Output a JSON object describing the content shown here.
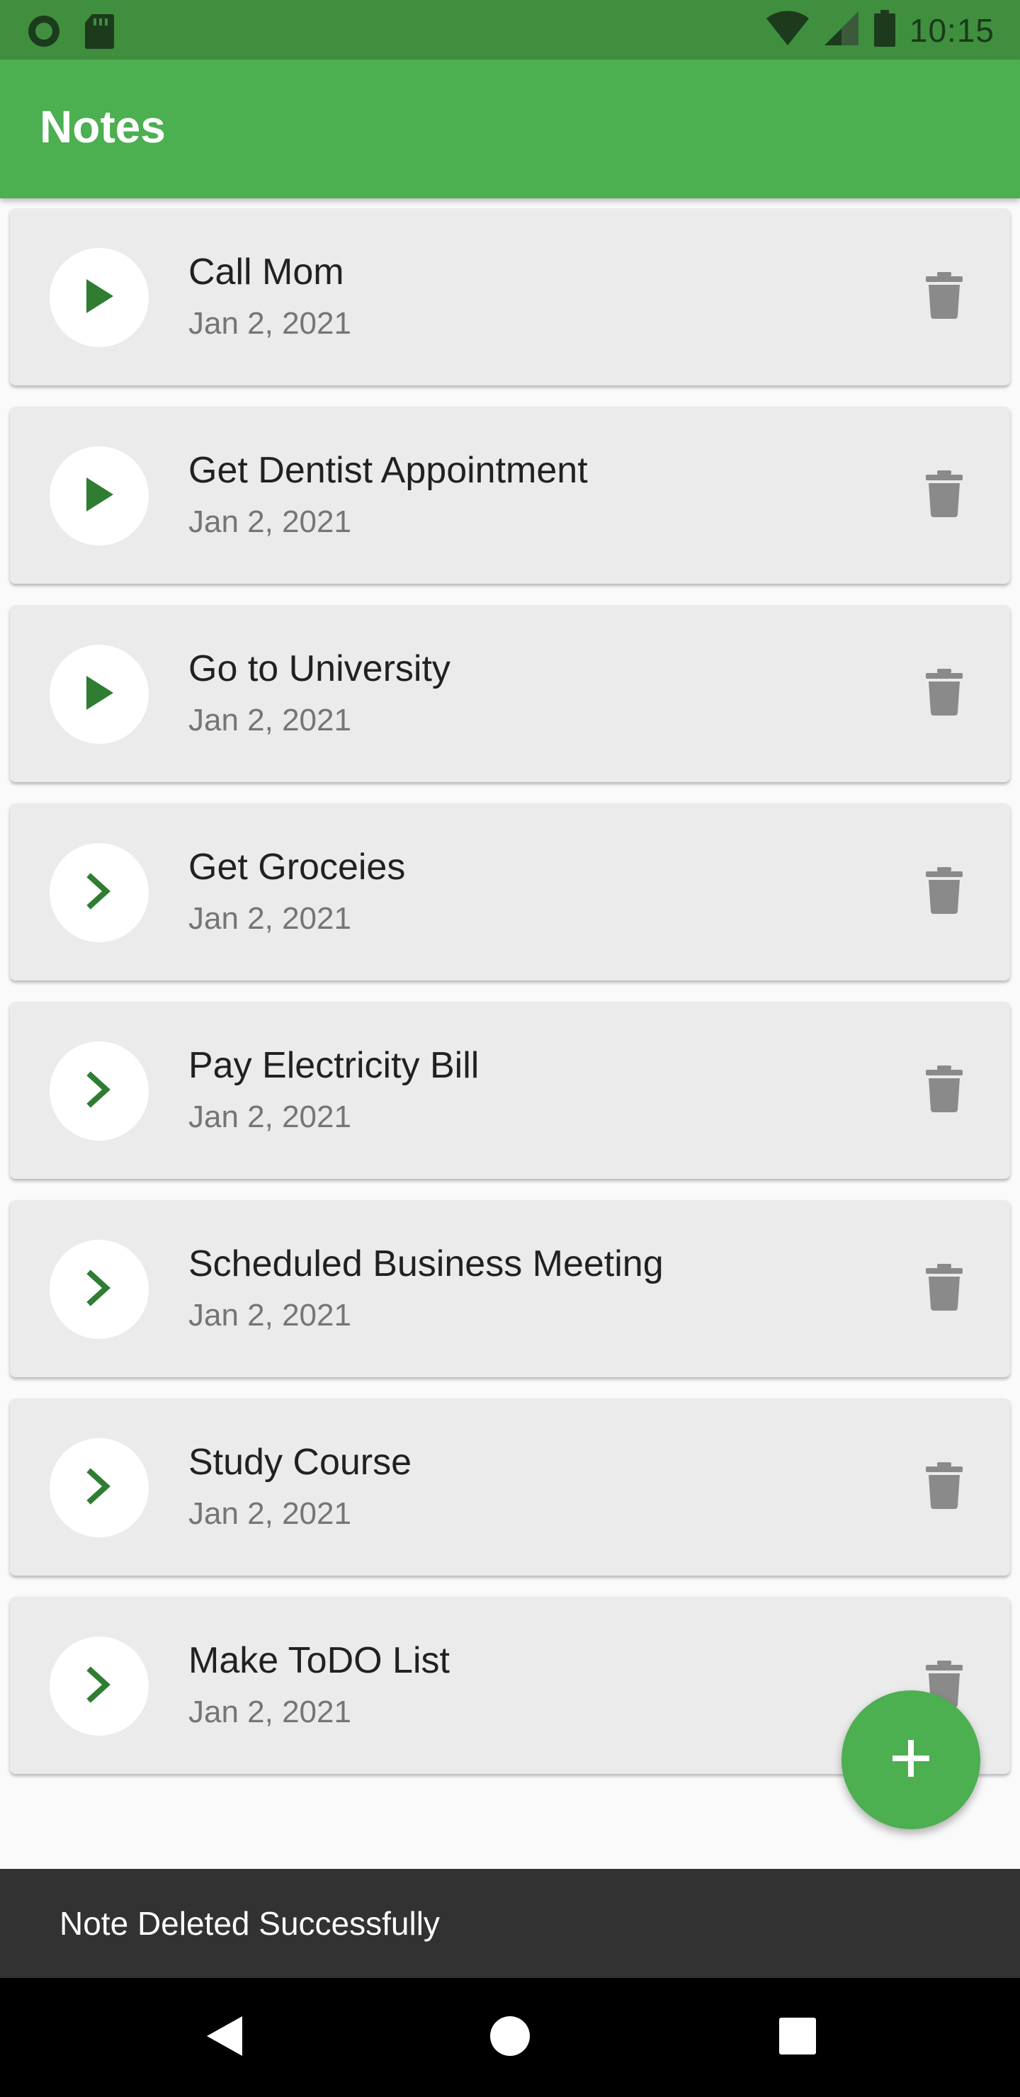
{
  "status_bar": {
    "time": "10:15",
    "icons": [
      "circle-status-icon",
      "sd-card-icon",
      "wifi-icon",
      "signal-icon",
      "battery-icon"
    ]
  },
  "app_bar": {
    "title": "Notes"
  },
  "notes": [
    {
      "title": "Call Mom",
      "date": "Jan 2, 2021",
      "icon": "play-icon"
    },
    {
      "title": "Get Dentist Appointment",
      "date": "Jan 2, 2021",
      "icon": "play-icon"
    },
    {
      "title": "Go to University",
      "date": "Jan 2, 2021",
      "icon": "play-icon"
    },
    {
      "title": "Get Groceies",
      "date": "Jan 2, 2021",
      "icon": "chevron-right-icon"
    },
    {
      "title": "Pay Electricity Bill",
      "date": "Jan 2, 2021",
      "icon": "chevron-right-icon"
    },
    {
      "title": "Scheduled Business Meeting",
      "date": "Jan 2, 2021",
      "icon": "chevron-right-icon"
    },
    {
      "title": "Study Course",
      "date": "Jan 2, 2021",
      "icon": "chevron-right-icon"
    },
    {
      "title": "Make ToDO List",
      "date": "Jan 2, 2021",
      "icon": "chevron-right-icon"
    }
  ],
  "fab": {
    "icon": "plus-icon"
  },
  "snackbar": {
    "message": "Note Deleted Successfully"
  },
  "nav_bar": {
    "icons": [
      "back-icon",
      "home-icon",
      "recents-icon"
    ]
  },
  "colors": {
    "primary": "#4caf50",
    "primary_dark": "#3f8f3f",
    "icon_green": "#2e7d32",
    "card_bg": "#ebebeb",
    "delete_gray": "#8a8a8a",
    "snackbar_bg": "#323232"
  }
}
